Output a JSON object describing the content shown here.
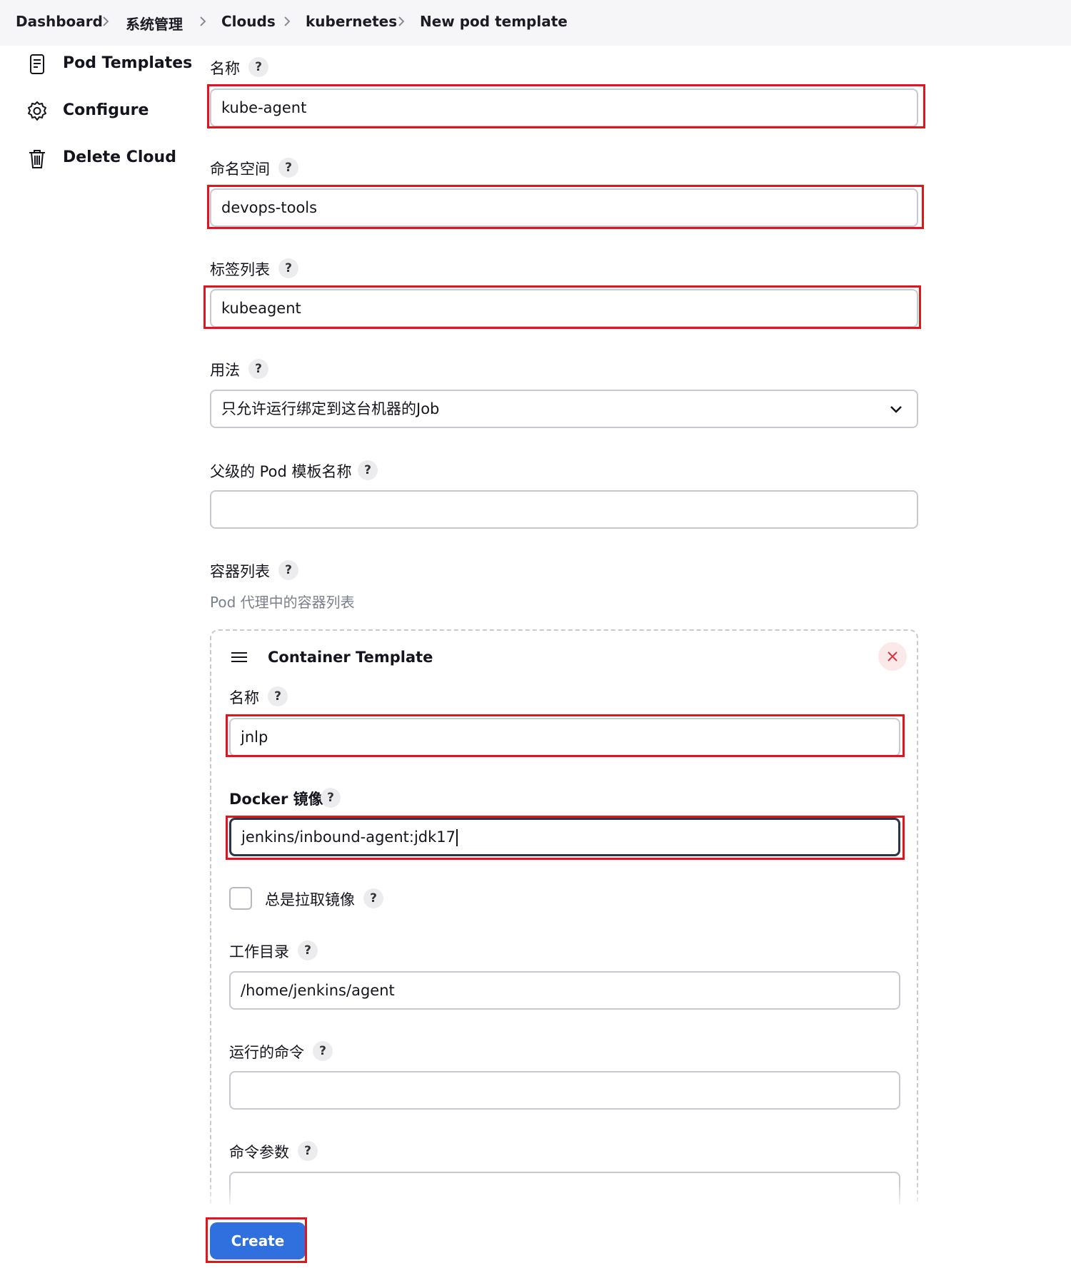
{
  "breadcrumb": {
    "items": [
      "Dashboard",
      "系统管理",
      "Clouds",
      "kubernetes",
      "New pod template"
    ]
  },
  "sidebar": {
    "items": [
      {
        "label": "Pod Templates",
        "icon": "document-icon"
      },
      {
        "label": "Configure",
        "icon": "gear-icon"
      },
      {
        "label": "Delete Cloud",
        "icon": "trash-icon"
      }
    ]
  },
  "help_glyph": "?",
  "form": {
    "name": {
      "label": "名称",
      "value": "kube-agent"
    },
    "namespace": {
      "label": "命名空间",
      "value": "devops-tools"
    },
    "labels": {
      "label": "标签列表",
      "value": "kubeagent"
    },
    "usage": {
      "label": "用法",
      "selected": "只允许运行绑定到这台机器的Job"
    },
    "parent_template": {
      "label": "父级的 Pod 模板名称",
      "value": ""
    },
    "containers": {
      "label": "容器列表",
      "description": "Pod 代理中的容器列表"
    }
  },
  "container_template": {
    "title": "Container Template",
    "name": {
      "label": "名称",
      "value": "jnlp"
    },
    "docker_image": {
      "label": "Docker 镜像",
      "value": "jenkins/inbound-agent:jdk17"
    },
    "always_pull": {
      "label": "总是拉取镜像",
      "checked": false
    },
    "working_dir": {
      "label": "工作目录",
      "value": "/home/jenkins/agent"
    },
    "command": {
      "label": "运行的命令",
      "value": ""
    },
    "args": {
      "label": "命令参数",
      "value": ""
    }
  },
  "actions": {
    "create_label": "Create"
  },
  "colors": {
    "highlight": "#e0151d",
    "primary": "#2f6fde",
    "close_icon": "#d9363e"
  }
}
